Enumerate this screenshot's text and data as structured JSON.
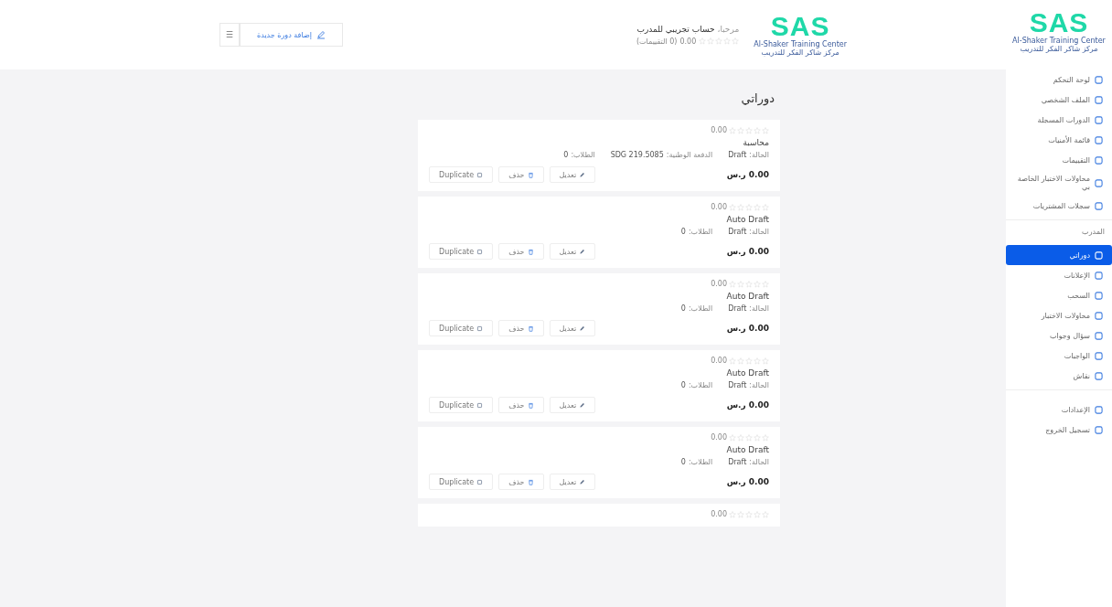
{
  "logo": {
    "mark": "SAS",
    "subtitle_en": "Al-Shaker Training Center",
    "subtitle_ar": "مركز شاكر الفكر للتدريب"
  },
  "header": {
    "logo_mark": "SAS",
    "logo_subtitle_en": "Al-Shaker Training Center",
    "logo_subtitle_ar": "مركز شاكر الفكر للتدريب",
    "greeting": "مرحبا،",
    "user": "حساب تجريبي للمدرب",
    "stars": 0,
    "rating": "0.00",
    "rating_count": "(0 التقييمات)",
    "add_course": "إضافة دورة جديدة",
    "menu": "☰"
  },
  "sidebar": {
    "items": [
      {
        "label": "لوحة التحكم",
        "selected": false
      },
      {
        "label": "الملف الشخصي",
        "selected": false
      },
      {
        "label": "الدورات المسجلة",
        "selected": false
      },
      {
        "label": "قائمة الأمنيات",
        "selected": false
      },
      {
        "label": "التقييمات",
        "selected": false
      },
      {
        "label": "محاولات الاختبار الخاصة بي",
        "selected": false
      },
      {
        "label": "سجلات المشتريات",
        "selected": false
      }
    ],
    "section": "المدرب",
    "instructor_items": [
      {
        "label": "دوراتي",
        "selected": true
      },
      {
        "label": "الإعلانات",
        "selected": false
      },
      {
        "label": "السحب",
        "selected": false
      },
      {
        "label": "محاولات الاختبار",
        "selected": false
      },
      {
        "label": "سؤال وجواب",
        "selected": false
      },
      {
        "label": "الواجبات",
        "selected": false
      },
      {
        "label": "نقاش",
        "selected": false
      }
    ],
    "bottom_items": [
      {
        "label": "الإعدادات",
        "selected": false
      },
      {
        "label": "تسجيل الخروج",
        "selected": false
      }
    ]
  },
  "page_title": "دوراتي",
  "courses": [
    {
      "stars": 0,
      "rating": "0.00",
      "title": "محاسبة",
      "status_label": "الحالة:",
      "status": "Draft",
      "price_label": "الدفعة الوطنية:",
      "price_value": "219.5085 SDG",
      "students_label": "الطلاب:",
      "students": "0",
      "price": "0.00 ر.س",
      "edit": "تعديل",
      "delete": "حذف",
      "duplicate": "Duplicate"
    },
    {
      "stars": 0,
      "rating": "0.00",
      "title": "Auto Draft",
      "status_label": "الحالة:",
      "status": "Draft",
      "students_label": "الطلاب:",
      "students": "0",
      "price": "0.00 ر.س",
      "edit": "تعديل",
      "delete": "حذف",
      "duplicate": "Duplicate"
    },
    {
      "stars": 0,
      "rating": "0.00",
      "title": "Auto Draft",
      "status_label": "الحالة:",
      "status": "Draft",
      "students_label": "الطلاب:",
      "students": "0",
      "price": "0.00 ر.س",
      "edit": "تعديل",
      "delete": "حذف",
      "duplicate": "Duplicate"
    },
    {
      "stars": 0,
      "rating": "0.00",
      "title": "Auto Draft",
      "status_label": "الحالة:",
      "status": "Draft",
      "students_label": "الطلاب:",
      "students": "0",
      "price": "0.00 ر.س",
      "edit": "تعديل",
      "delete": "حذف",
      "duplicate": "Duplicate"
    },
    {
      "stars": 0,
      "rating": "0.00",
      "title": "Auto Draft",
      "status_label": "الحالة:",
      "status": "Draft",
      "students_label": "الطلاب:",
      "students": "0",
      "price": "0.00 ر.س",
      "edit": "تعديل",
      "delete": "حذف",
      "duplicate": "Duplicate"
    },
    {
      "stars": 0,
      "rating": "0.00"
    }
  ]
}
